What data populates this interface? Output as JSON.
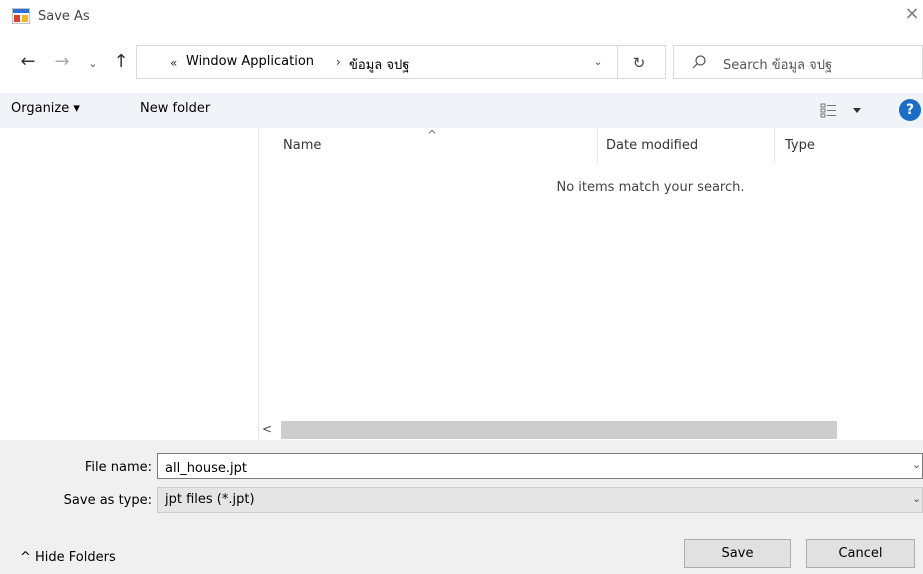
{
  "window": {
    "title": "Save As",
    "app_icon": "app-window-icon",
    "close_icon": "close-icon"
  },
  "nav": {
    "back_icon": "arrow-left-icon",
    "forward_icon": "arrow-right-icon",
    "recent_icon": "chevron-down-icon",
    "up_icon": "arrow-up-icon"
  },
  "address": {
    "overflow_glyph": "«",
    "crumbs": [
      "Window Application",
      "ข้อมูล จปฐ"
    ],
    "separator_glyph": "›",
    "dropdown_icon": "chevron-down-icon",
    "refresh_icon": "refresh-icon"
  },
  "search": {
    "placeholder": "Search ข้อมูล จปฐ",
    "icon": "search-icon"
  },
  "toolbar": {
    "organize_label": "Organize ▾",
    "new_folder_label": "New folder",
    "view_icon": "view-options-icon",
    "help_icon": "help-icon",
    "help_glyph": "?"
  },
  "file_list": {
    "columns": [
      "Name",
      "Date modified",
      "Type"
    ],
    "empty_message": "No items match your search.",
    "sort_indicator": "^"
  },
  "scrollbar": {
    "left_arrow": "<"
  },
  "form": {
    "file_name_label": "File name:",
    "file_name_value": "all_house.jpt",
    "save_type_label": "Save as type:",
    "save_type_value": "jpt files (*.jpt)",
    "dropdown_glyph": "⌄"
  },
  "footer": {
    "hide_folders_label": "^  Hide Folders",
    "save_label": "Save",
    "cancel_label": "Cancel"
  },
  "colors": {
    "toolbar_bg": "#f0f4f9",
    "bottom_bg": "#f0f0f0",
    "help_blue": "#1a6ec9",
    "button_bg": "#e1e1e1"
  }
}
